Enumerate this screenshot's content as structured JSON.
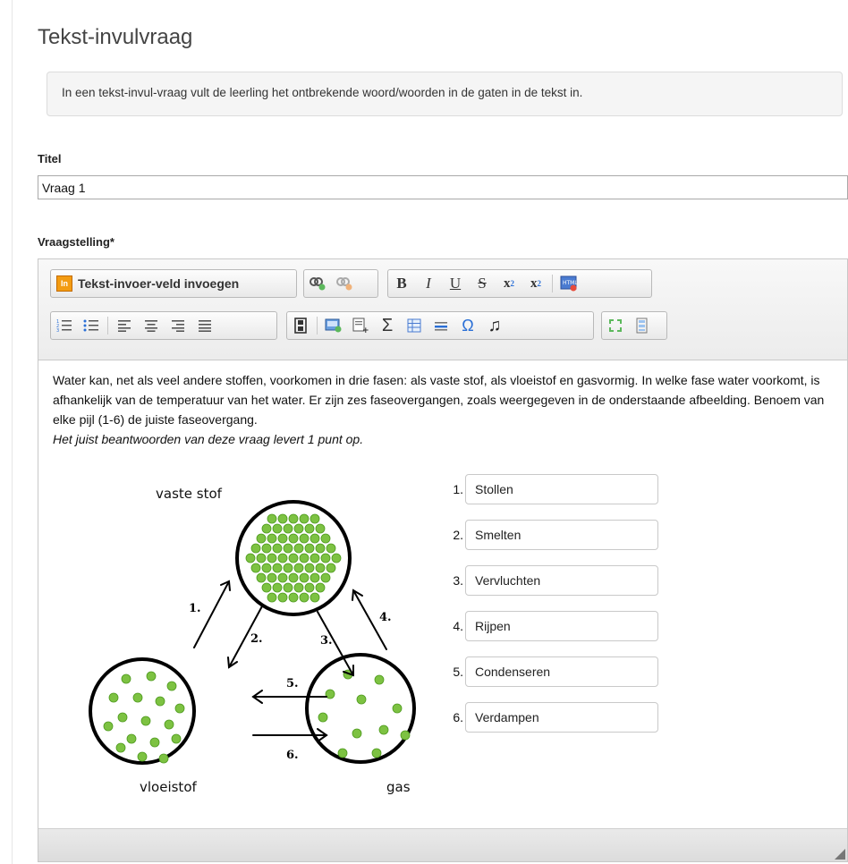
{
  "page": {
    "title": "Tekst-invulvraag",
    "intro": "In een tekst-invul-vraag vult de leerling het ontbrekende woord/woorden in de gaten in de tekst in."
  },
  "form": {
    "title_label": "Titel",
    "title_value": "Vraag 1",
    "question_label": "Vraagstelling*"
  },
  "toolbar": {
    "row1": {
      "insert_button": "Tekst-invoer-veld invoegen",
      "icons": [
        "link-icon",
        "unlink-icon",
        "bold-icon",
        "italic-icon",
        "underline-icon",
        "strikethrough-icon",
        "subscript-icon",
        "superscript-icon",
        "html-source-icon"
      ]
    },
    "row2": {
      "icons": [
        "numbered-list-icon",
        "bulleted-list-icon",
        "align-left-icon",
        "align-center-icon",
        "align-right-icon",
        "justify-icon",
        "media-icon",
        "insert-image-icon",
        "insert-file-icon",
        "sigma-icon",
        "table-icon",
        "horizontal-rule-icon",
        "omega-icon",
        "music-icon",
        "maximize-icon",
        "show-blocks-icon"
      ]
    }
  },
  "question": {
    "text": "Water kan, net als veel andere stoffen, voorkomen in drie fasen: als vaste stof, als vloeistof en gasvormig. In welke fase water voorkomt, is afhankelijk van de temperatuur van het water. Er zijn zes faseovergangen, zoals weergegeven in de onderstaande afbeelding. Benoem van elke pijl (1-6) de juiste faseovergang.",
    "note": "Het juist beantwoorden van deze vraag levert 1 punt op."
  },
  "diagram": {
    "labels": {
      "solid": "vaste stof",
      "liquid": "vloeistof",
      "gas": "gas"
    },
    "arrows": [
      "1.",
      "2.",
      "3.",
      "4.",
      "5.",
      "6."
    ]
  },
  "answers": [
    {
      "num": "1.",
      "value": "Stollen"
    },
    {
      "num": "2.",
      "value": "Smelten"
    },
    {
      "num": "3.",
      "value": "Vervluchten"
    },
    {
      "num": "4.",
      "value": "Rijpen"
    },
    {
      "num": "5.",
      "value": "Condenseren"
    },
    {
      "num": "6.",
      "value": "Verdampen"
    }
  ],
  "colors": {
    "particle": "#7dc242",
    "particle_edge": "#4e9a1e"
  }
}
